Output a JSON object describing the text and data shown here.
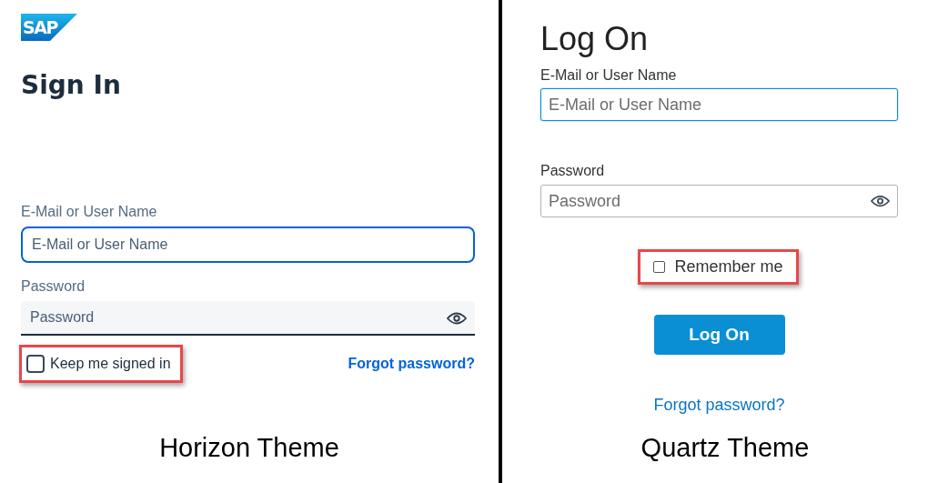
{
  "panels": [
    {
      "kind": "horizon",
      "logo": "SAP",
      "title": "Sign In",
      "user_label": "E-Mail or User Name",
      "user_placeholder": "E-Mail or User Name",
      "password_label": "Password",
      "password_placeholder": "Password",
      "remember": {
        "label": "Keep me signed in",
        "checked": false,
        "highlighted": true
      },
      "forgot_link": "Forgot password?",
      "caption": "Horizon Theme"
    },
    {
      "kind": "quartz",
      "title": "Log On",
      "user_label": "E-Mail or User Name",
      "user_placeholder": "E-Mail or User Name",
      "password_label": "Password",
      "password_placeholder": "Password",
      "remember": {
        "label": "Remember me",
        "checked": false,
        "highlighted": true
      },
      "button": "Log On",
      "forgot_link": "Forgot password?",
      "caption": "Quartz Theme"
    }
  ]
}
